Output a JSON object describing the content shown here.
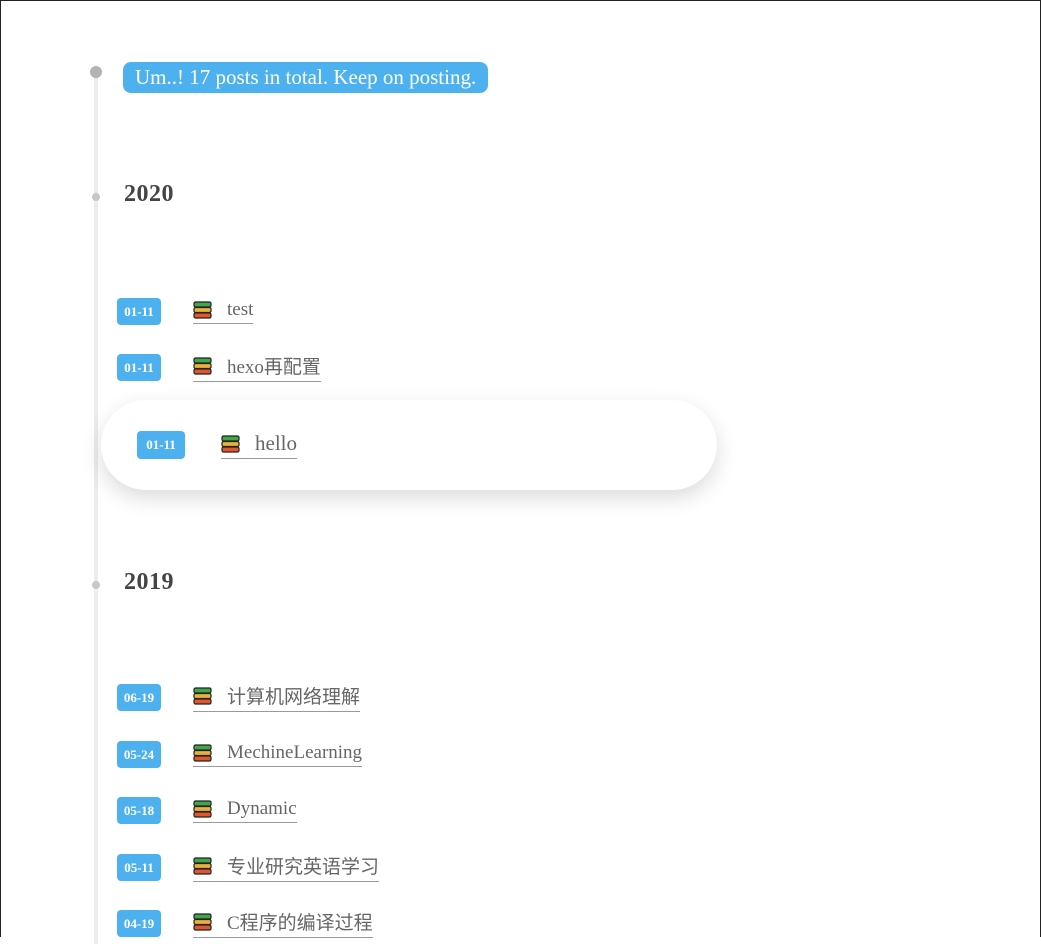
{
  "archive": {
    "total_label": "Um..! 17 posts in total. Keep on posting."
  },
  "years": [
    {
      "year": "2020",
      "posts": [
        {
          "date": "01-11",
          "title": "test"
        },
        {
          "date": "01-11",
          "title": "hexo再配置"
        },
        {
          "date": "01-11",
          "title": "hello"
        }
      ]
    },
    {
      "year": "2019",
      "posts": [
        {
          "date": "06-19",
          "title": "计算机网络理解"
        },
        {
          "date": "05-24",
          "title": "MechineLearning"
        },
        {
          "date": "05-18",
          "title": "Dynamic"
        },
        {
          "date": "05-11",
          "title": "专业研究英语学习"
        },
        {
          "date": "04-19",
          "title": "C程序的编译过程"
        }
      ]
    }
  ],
  "colors": {
    "accent": "#4cb1ee",
    "timeline": "#ececec"
  }
}
